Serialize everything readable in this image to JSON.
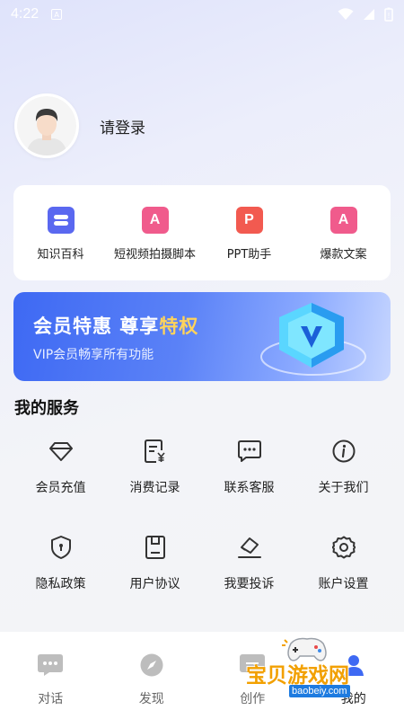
{
  "status": {
    "time": "4:22",
    "notif_badge": "A"
  },
  "profile": {
    "login_text": "请登录"
  },
  "tools": [
    {
      "label": "知识百科",
      "icon": "encyclopedia-icon",
      "color": "#5a68f0",
      "glyph": ""
    },
    {
      "label": "短视频拍摄脚本",
      "icon": "doc-a-icon",
      "color": "#f05b8c",
      "glyph": "A"
    },
    {
      "label": "PPT助手",
      "icon": "ppt-icon",
      "color": "#f25a50",
      "glyph": "P"
    },
    {
      "label": "爆款文案",
      "icon": "doc-a-icon",
      "color": "#f05b8c",
      "glyph": "A"
    }
  ],
  "vip": {
    "title_main": "会员特惠 尊享",
    "title_gold": "特权",
    "subtitle": "VIP会员畅享所有功能"
  },
  "services": {
    "title": "我的服务",
    "items": [
      {
        "label": "会员充值",
        "icon": "diamond-icon"
      },
      {
        "label": "消费记录",
        "icon": "receipt-yen-icon"
      },
      {
        "label": "联系客服",
        "icon": "chat-dots-icon"
      },
      {
        "label": "关于我们",
        "icon": "info-icon"
      },
      {
        "label": "隐私政策",
        "icon": "shield-icon"
      },
      {
        "label": "用户协议",
        "icon": "document-icon"
      },
      {
        "label": "我要投诉",
        "icon": "complaint-icon"
      },
      {
        "label": "账户设置",
        "icon": "gear-icon"
      }
    ]
  },
  "tabs": [
    {
      "label": "对话",
      "icon": "chat-bubble-icon"
    },
    {
      "label": "发现",
      "icon": "compass-icon"
    },
    {
      "label": "创作",
      "icon": "create-icon"
    },
    {
      "label": "我的",
      "icon": "profile-icon"
    }
  ],
  "watermark": {
    "main": "宝贝游戏网",
    "url": "baobeiy.com"
  },
  "colors": {
    "accent": "#3e69f3",
    "gold": "#ffd35b",
    "icon_gray": "#333333"
  }
}
